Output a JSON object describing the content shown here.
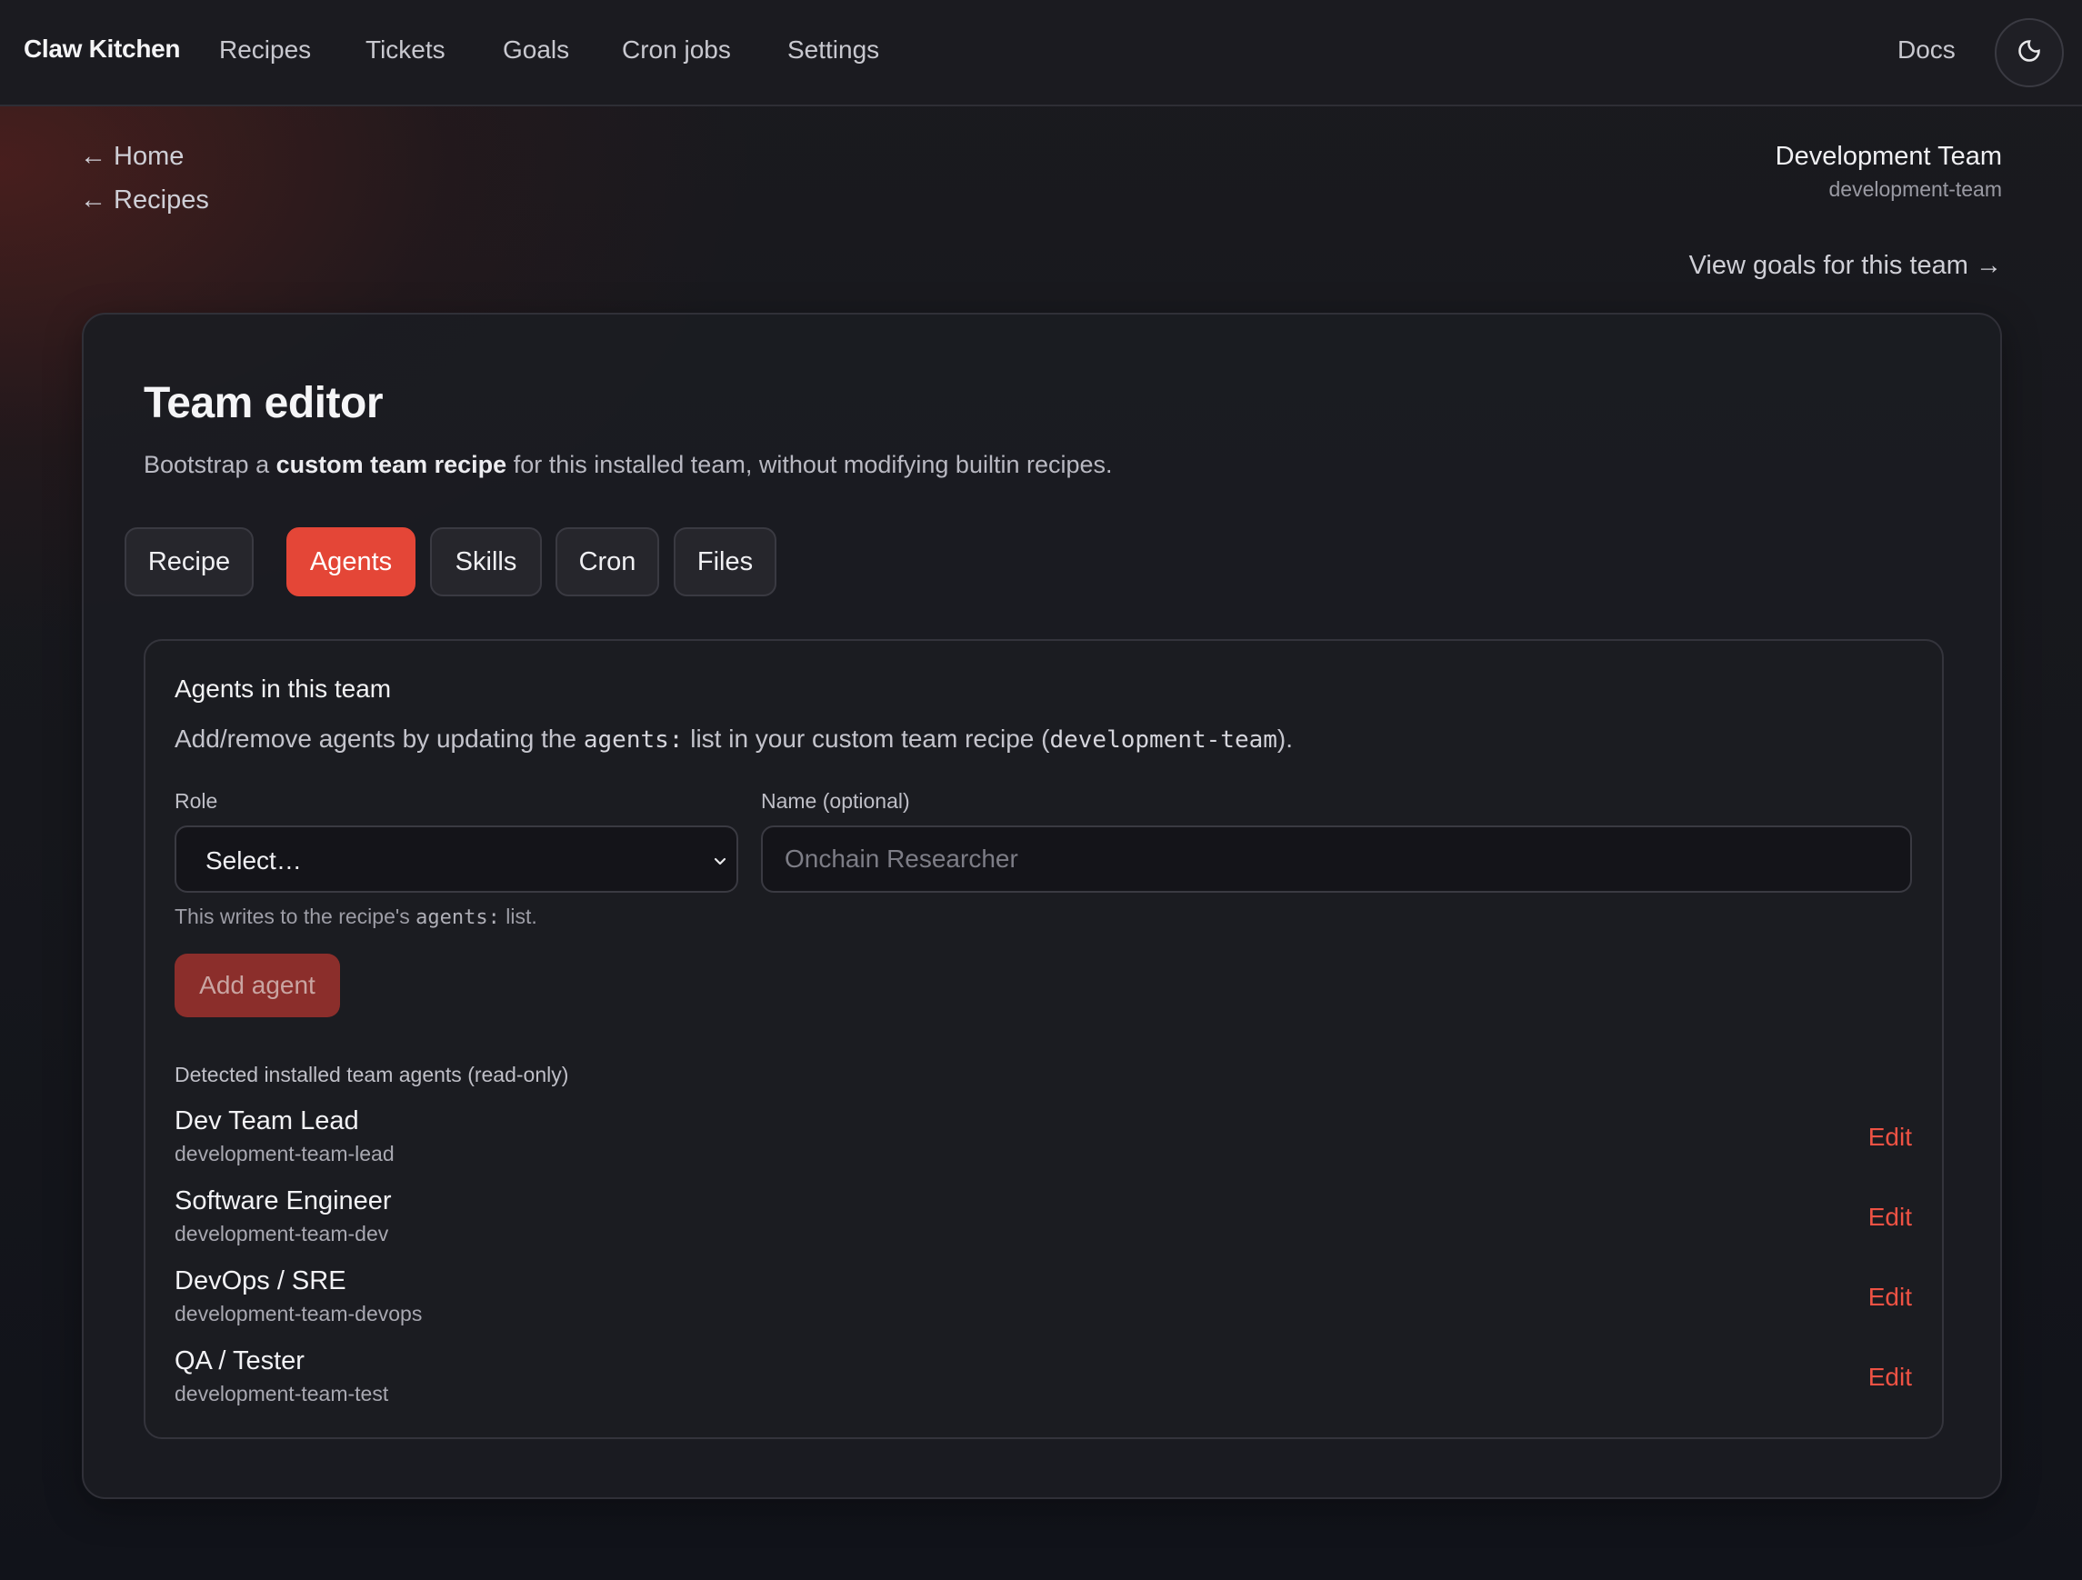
{
  "nav": {
    "brand": "Claw Kitchen",
    "links": [
      "Recipes",
      "Tickets",
      "Goals",
      "Cron jobs",
      "Settings"
    ],
    "docs": "Docs",
    "theme_icon": "moon-icon"
  },
  "breadcrumbs": [
    "← Home",
    "← Recipes"
  ],
  "team": {
    "title": "Development Team",
    "slug": "development-team",
    "view_goals": "View goals for this team →"
  },
  "editor": {
    "title": "Team editor",
    "subtitle_pre": "Bootstrap a ",
    "subtitle_bold": "custom team recipe",
    "subtitle_post": " for this installed team, without modifying builtin recipes.",
    "tabs": [
      "Recipe",
      "Agents",
      "Skills",
      "Cron",
      "Files"
    ],
    "active_tab": "Agents"
  },
  "agents_panel": {
    "title": "Agents in this team",
    "desc_pre": "Add/remove agents by updating the ",
    "desc_code1": "agents:",
    "desc_mid": " list in your custom team recipe (",
    "desc_code2": "development-team",
    "desc_post": ").",
    "role_label": "Role",
    "role_value": "Select…",
    "name_label": "Name (optional)",
    "name_placeholder": "Onchain Researcher",
    "name_value": "",
    "hint_pre": "This writes to the recipe's ",
    "hint_code": "agents:",
    "hint_post": " list.",
    "add_button": "Add agent",
    "detected_label": "Detected installed team agents (read-only)",
    "edit_label": "Edit",
    "agents": [
      {
        "name": "Dev Team Lead",
        "id": "development-team-lead"
      },
      {
        "name": "Software Engineer",
        "id": "development-team-dev"
      },
      {
        "name": "DevOps / SRE",
        "id": "development-team-devops"
      },
      {
        "name": "QA / Tester",
        "id": "development-team-test"
      }
    ]
  },
  "colors": {
    "accent": "#e44637",
    "edit_link": "#ef5244",
    "add_button_disabled": "#8b2e2b"
  }
}
